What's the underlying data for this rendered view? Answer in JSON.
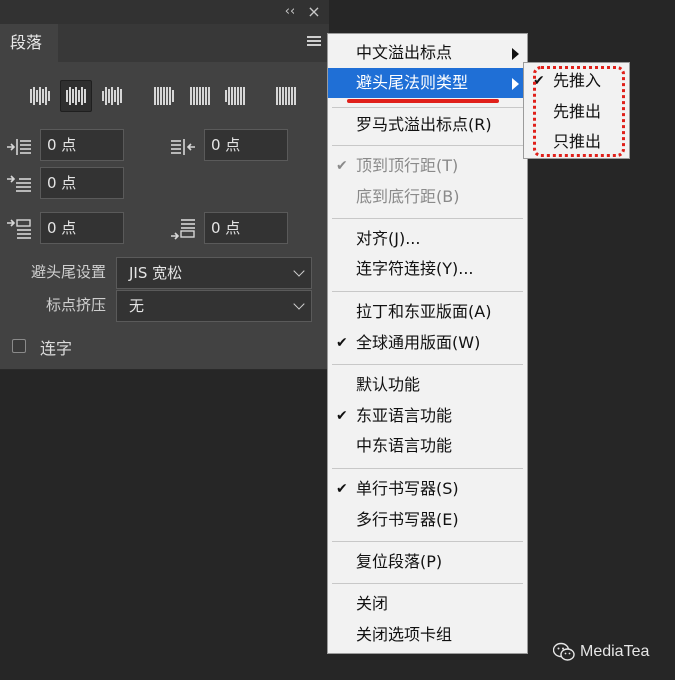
{
  "panel": {
    "tab_label": "段落",
    "collapse_glyph": "‹‹",
    "close_glyph": "×",
    "fields": {
      "left_indent": "0 点",
      "right_indent": "0 点",
      "first_line_indent": "0 点",
      "space_before": "0 点",
      "space_after": "0 点"
    },
    "kinsoku_label": "避头尾设置",
    "kinsoku_value": "JIS 宽松",
    "mojikumi_label": "标点挤压",
    "mojikumi_value": "无",
    "hyphenate_label": "连字"
  },
  "menu": {
    "items": [
      {
        "label": "中文溢出标点",
        "check": ""
      },
      {
        "label": "避头尾法则类型",
        "check": ""
      },
      {
        "label": "罗马式溢出标点(R)",
        "check": ""
      },
      {
        "label": "顶到顶行距(T)",
        "check": "✔"
      },
      {
        "label": "底到底行距(B)",
        "check": ""
      },
      {
        "label": "对齐(J)...",
        "check": ""
      },
      {
        "label": "连字符连接(Y)...",
        "check": ""
      },
      {
        "label": "拉丁和东亚版面(A)",
        "check": ""
      },
      {
        "label": "全球通用版面(W)",
        "check": "✔"
      },
      {
        "label": "默认功能",
        "check": ""
      },
      {
        "label": "东亚语言功能",
        "check": "✔"
      },
      {
        "label": "中东语言功能",
        "check": ""
      },
      {
        "label": "单行书写器(S)",
        "check": "✔"
      },
      {
        "label": "多行书写器(E)",
        "check": ""
      },
      {
        "label": "复位段落(P)",
        "check": ""
      },
      {
        "label": "关闭",
        "check": ""
      },
      {
        "label": "关闭选项卡组",
        "check": ""
      }
    ]
  },
  "submenu": {
    "items": [
      {
        "label": "先推入",
        "check": "✔"
      },
      {
        "label": "先推出",
        "check": ""
      },
      {
        "label": "只推出",
        "check": ""
      }
    ]
  },
  "watermark": {
    "text": "MediaTea"
  },
  "colors": {
    "highlight": "#1f6fd6",
    "annotation_red": "#e0201a",
    "panel_bg": "#424242",
    "menu_bg": "#f2f2f2"
  }
}
